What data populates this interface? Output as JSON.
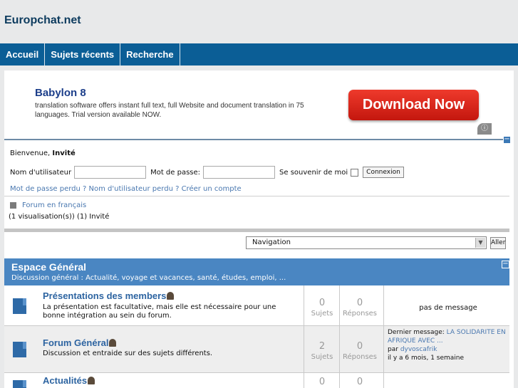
{
  "site": {
    "title": "Europchat.net"
  },
  "nav": {
    "items": [
      "Accueil",
      "Sujets récents",
      "Recherche"
    ]
  },
  "ad": {
    "title": "Babylon 8",
    "text": "translation software offers instant full text, full Website and document translation in 75 languages. Trial version available NOW.",
    "button": "Download Now",
    "info_icon": "info-icon"
  },
  "welcome": {
    "greeting": "Bienvenue,",
    "user": "Invité",
    "username_label": "Nom d'utilisateur",
    "password_label": "Mot de passe:",
    "remember_label": "Se souvenir de moi",
    "login_button": "Connexion",
    "lost_links": "Mot de passe perdu ? Nom d'utilisateur perdu ? Créer un compte",
    "forum_lang": "Forum en français",
    "viewers": "(1 visualisation(s)) (1) Invité"
  },
  "navigation": {
    "select_value": "Navigation",
    "go_button": "Aller"
  },
  "category": {
    "title": "Espace Général",
    "description": "Discussion général : Actualité, voyage et vacances, santé, études, emploi, ...",
    "forums": [
      {
        "name": "Présentations des members",
        "description": "La présentation est facultative, mais elle est nécessaire pour une bonne intégration au sein du forum.",
        "topics": "0",
        "topics_label": "Sujets",
        "replies": "0",
        "replies_label": "Réponses",
        "last": "pas de message"
      },
      {
        "name": "Forum Général",
        "description": "Discussion et entraide sur des sujets différents.",
        "topics": "2",
        "topics_label": "Sujets",
        "replies": "0",
        "replies_label": "Réponses",
        "last_prefix": "Dernier message:",
        "last_link": "LA SOLIDARITE EN AFRIQUE AVEC ...",
        "last_by": "par",
        "last_author": "dyvoscafrik",
        "last_time": "il y a 6 mois, 1 semaine"
      },
      {
        "name": "Actualités",
        "topics": "0",
        "replies": "0"
      }
    ]
  },
  "colors": {
    "navbar": "#0b5e96",
    "category_header": "#4a86c2",
    "link": "#2d64a1"
  }
}
